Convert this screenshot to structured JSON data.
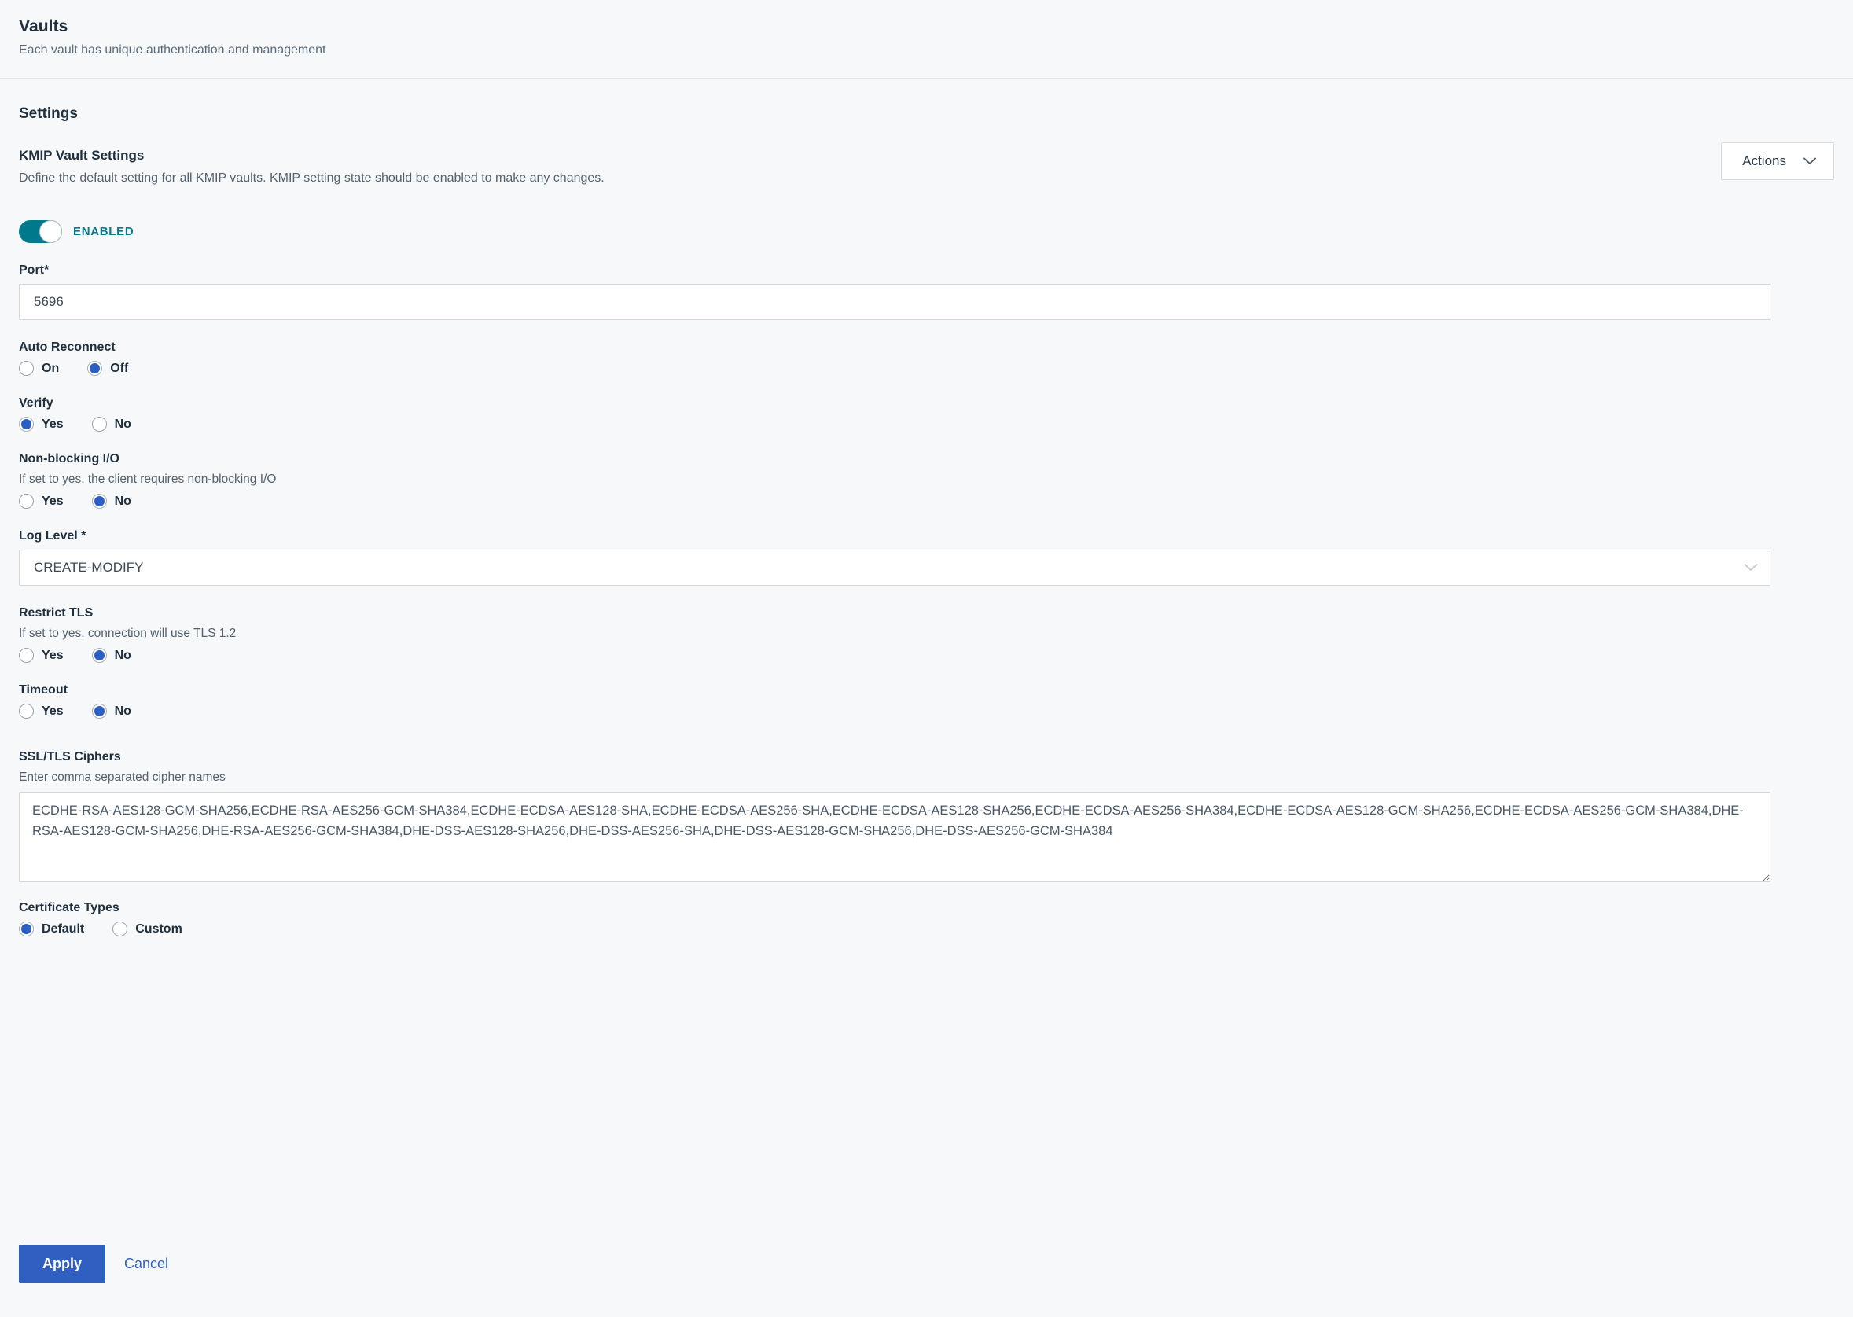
{
  "header": {
    "title": "Vaults",
    "subtitle": "Each vault has unique authentication and management"
  },
  "settings": {
    "section_title": "Settings",
    "subsection_title": "KMIP Vault Settings",
    "subsection_desc": "Define the default setting for all KMIP vaults. KMIP setting state should be enabled to make any changes.",
    "actions_button": "Actions"
  },
  "toggle": {
    "state_label": "ENABLED",
    "checked": true,
    "color": "#00798c"
  },
  "fields": {
    "port": {
      "label": "Port",
      "required_marker": "*",
      "value": "5696"
    },
    "auto_reconnect": {
      "label": "Auto Reconnect",
      "options": [
        "On",
        "Off"
      ],
      "selected": "Off"
    },
    "verify": {
      "label": "Verify",
      "options": [
        "Yes",
        "No"
      ],
      "selected": "Yes"
    },
    "non_blocking_io": {
      "label": "Non-blocking I/O",
      "hint": "If set to yes, the client requires non-blocking I/O",
      "options": [
        "Yes",
        "No"
      ],
      "selected": "No"
    },
    "log_level": {
      "label": "Log Level *",
      "value": "CREATE-MODIFY"
    },
    "restrict_tls": {
      "label": "Restrict TLS",
      "hint": "If set to yes, connection will use TLS 1.2",
      "options": [
        "Yes",
        "No"
      ],
      "selected": "No"
    },
    "timeout": {
      "label": "Timeout",
      "options": [
        "Yes",
        "No"
      ],
      "selected": "No"
    },
    "ssl_tls_ciphers": {
      "label": "SSL/TLS Ciphers",
      "hint": "Enter comma separated cipher names",
      "value": "ECDHE-RSA-AES128-GCM-SHA256,ECDHE-RSA-AES256-GCM-SHA384,ECDHE-ECDSA-AES128-SHA,ECDHE-ECDSA-AES256-SHA,ECDHE-ECDSA-AES128-SHA256,ECDHE-ECDSA-AES256-SHA384,ECDHE-ECDSA-AES128-GCM-SHA256,ECDHE-ECDSA-AES256-GCM-SHA384,DHE-RSA-AES128-GCM-SHA256,DHE-RSA-AES256-GCM-SHA384,DHE-DSS-AES128-SHA256,DHE-DSS-AES256-SHA,DHE-DSS-AES128-GCM-SHA256,DHE-DSS-AES256-GCM-SHA384"
    },
    "certificate_types": {
      "label": "Certificate Types",
      "options": [
        "Default",
        "Custom"
      ],
      "selected": "Default"
    }
  },
  "footer": {
    "apply_label": "Apply",
    "cancel_label": "Cancel",
    "apply_color": "#2f5fc0"
  }
}
